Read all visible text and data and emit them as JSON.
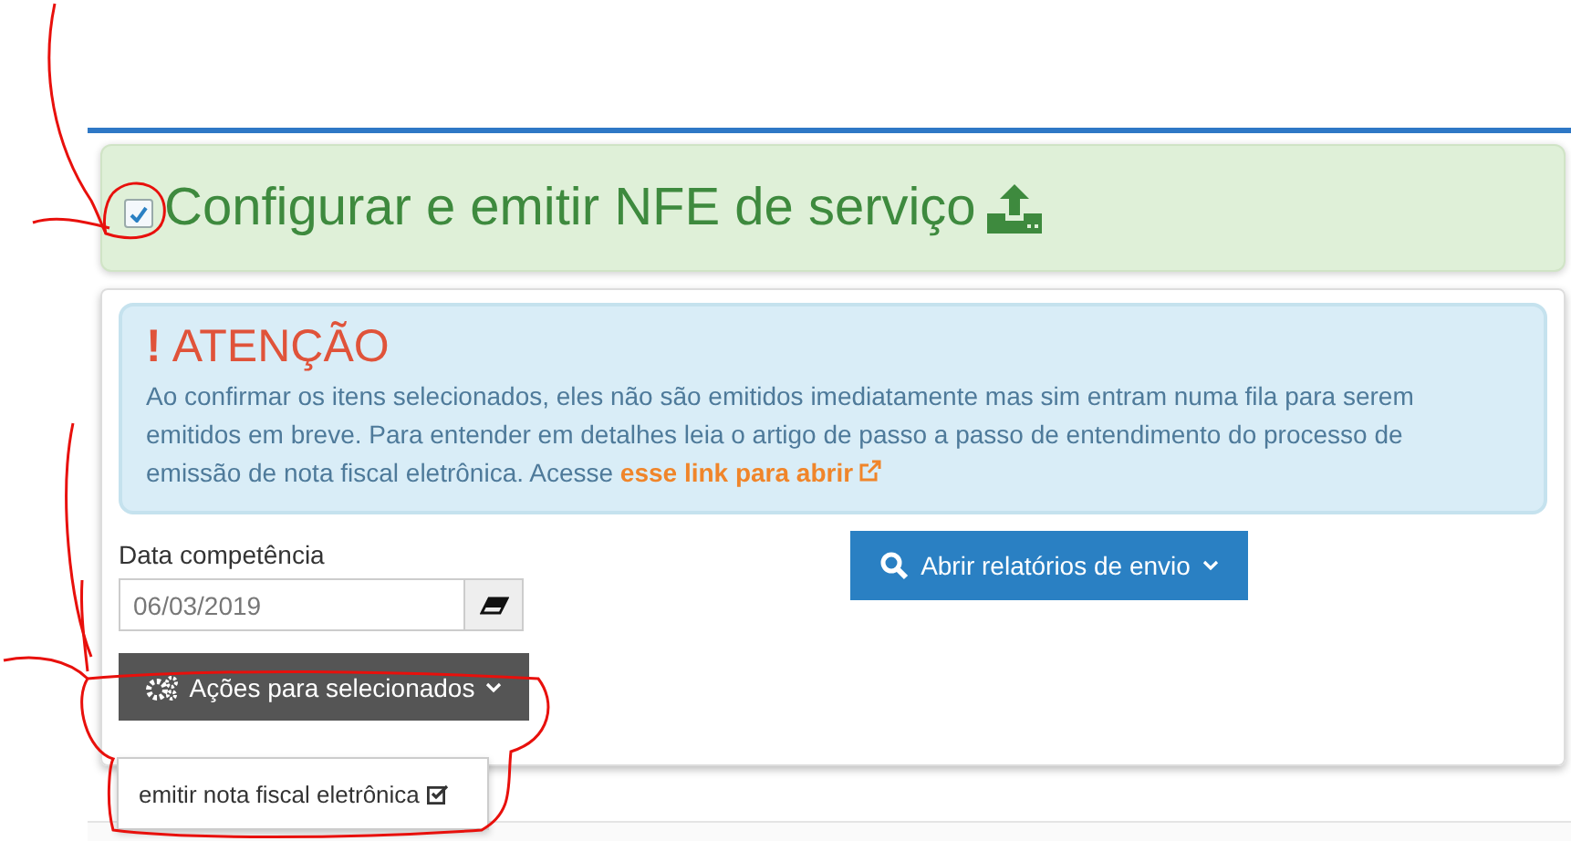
{
  "header": {
    "checked": true,
    "title": "Configurar e emitir NFE de serviço"
  },
  "alert": {
    "icon": "!",
    "title": "ATENÇÃO",
    "text": "Ao confirmar os itens selecionados, eles não são emitidos imediatamente mas sim entram numa fila para serem emitidos em breve. Para entender em detalhes leia o artigo de passo a passo de entendimento do processo de emissão de nota fiscal eletrônica. Acesse",
    "link": "esse link para abrir"
  },
  "date_field": {
    "label": "Data competência",
    "value": "06/03/2019"
  },
  "reports_button": {
    "label": "Abrir relatórios de envio"
  },
  "actions_menu": {
    "label": "Ações para selecionados",
    "expanded": true,
    "items": [
      {
        "label": "emitir nota fiscal eletrônica"
      }
    ]
  }
}
